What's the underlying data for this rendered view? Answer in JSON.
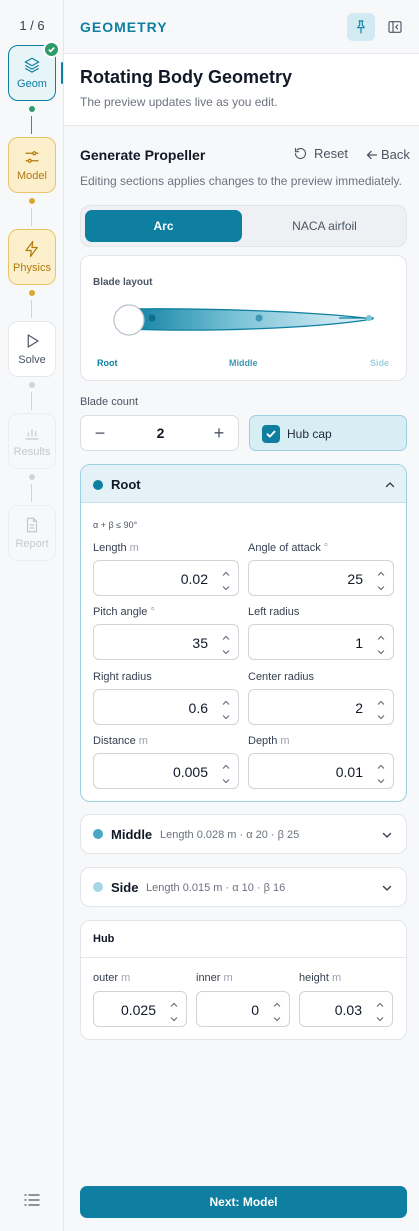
{
  "rail": {
    "counter": "1 / 6",
    "steps": [
      {
        "label": "Geom",
        "icon": "layers-icon",
        "state": "complete-active"
      },
      {
        "label": "Model",
        "icon": "sliders-icon",
        "state": "pending"
      },
      {
        "label": "Physics",
        "icon": "lightning-icon",
        "state": "pending"
      },
      {
        "label": "Solve",
        "icon": "play-icon",
        "state": "available"
      },
      {
        "label": "Results",
        "icon": "bar-chart-icon",
        "state": "disabled"
      },
      {
        "label": "Report",
        "icon": "document-icon",
        "state": "disabled"
      }
    ]
  },
  "header": {
    "title": "GEOMETRY",
    "pin_icon": "pin-icon",
    "collapse_icon": "sidebar-collapse-icon"
  },
  "page": {
    "title": "Rotating Body Geometry",
    "subtitle": "The preview updates live as you edit."
  },
  "section": {
    "title": "Generate Propeller",
    "reset_label": "Reset",
    "back_label": "Back",
    "description": "Editing sections applies changes to the preview immediately."
  },
  "profile_toggle": {
    "options": [
      "Arc",
      "NACA airfoil"
    ],
    "selected": "Arc"
  },
  "blade_layout": {
    "label": "Blade layout",
    "positions": [
      "Root",
      "Middle",
      "Side"
    ]
  },
  "blade_count": {
    "label": "Blade count",
    "value": "2",
    "minus": "−",
    "plus": "+"
  },
  "hub_cap": {
    "label": "Hub cap",
    "checked": true
  },
  "root": {
    "name": "Root",
    "constraint": "α + β ≤ 90°",
    "fields": [
      {
        "label": "Length",
        "unit": "m",
        "value": "0.02"
      },
      {
        "label": "Angle of attack",
        "unit": "°",
        "value": "25"
      },
      {
        "label": "Pitch angle",
        "unit": "°",
        "value": "35"
      },
      {
        "label": "Left radius",
        "unit": "",
        "value": "1"
      },
      {
        "label": "Right radius",
        "unit": "",
        "value": "0.6"
      },
      {
        "label": "Center radius",
        "unit": "",
        "value": "2"
      },
      {
        "label": "Distance",
        "unit": "m",
        "value": "0.005"
      },
      {
        "label": "Depth",
        "unit": "m",
        "value": "0.01"
      }
    ]
  },
  "middle": {
    "name": "Middle",
    "summary": "Length 0.028 m · α 20 · β 25"
  },
  "side": {
    "name": "Side",
    "summary": "Length 0.015 m · α 10 · β 16"
  },
  "hub": {
    "title": "Hub",
    "fields": [
      {
        "label": "outer",
        "unit": "m",
        "value": "0.025"
      },
      {
        "label": "inner",
        "unit": "m",
        "value": "0"
      },
      {
        "label": "height",
        "unit": "m",
        "value": "0.03"
      }
    ]
  },
  "footer": {
    "next_label": "Next: Model"
  },
  "colors": {
    "accent": "#0e7fa1",
    "pending": "#e9c46a",
    "complete": "#2e9b6a"
  }
}
